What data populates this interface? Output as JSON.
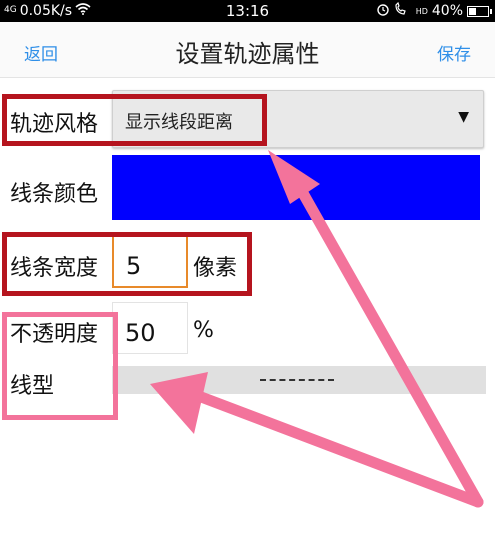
{
  "status_bar": {
    "signal": "4G",
    "speed": "0.05K/s",
    "time": "13:16",
    "hd": "HD",
    "battery": "40%",
    "battery_level": 0.4
  },
  "nav": {
    "back": "返回",
    "title": "设置轨迹属性",
    "save": "保存"
  },
  "form": {
    "style_label": "轨迹风格",
    "style_value": "显示线段距离",
    "color_label": "线条颜色",
    "color_value": "#0000ff",
    "width_label": "线条宽度",
    "width_value": "5",
    "width_unit": "像素",
    "opacity_label": "不透明度",
    "opacity_value": "50",
    "opacity_unit": "%",
    "linetype_label": "线型"
  },
  "colors": {
    "accent": "#2f8fe8",
    "annotation_red": "#b5141e",
    "annotation_pink": "#f3739b",
    "focus_border": "#e88a2a"
  }
}
